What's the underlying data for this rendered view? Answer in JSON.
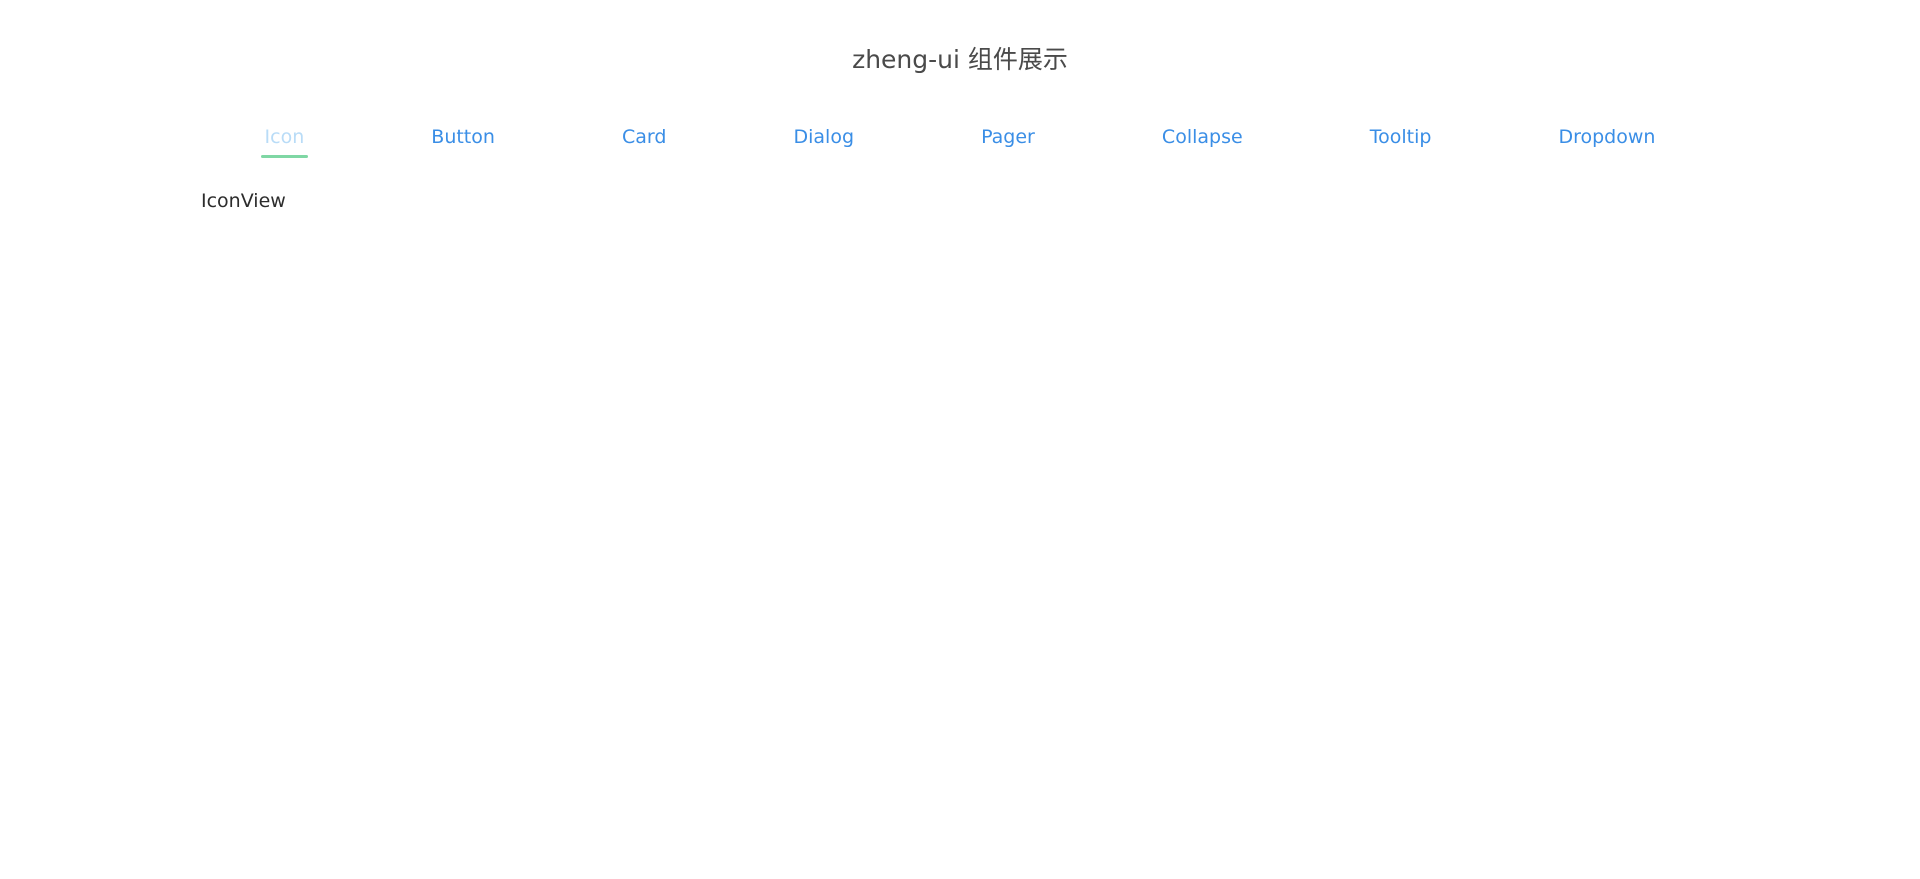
{
  "header": {
    "title": "zheng-ui 组件展示"
  },
  "nav": {
    "items": [
      {
        "label": "Icon",
        "active": true
      },
      {
        "label": "Button",
        "active": false
      },
      {
        "label": "Card",
        "active": false
      },
      {
        "label": "Dialog",
        "active": false
      },
      {
        "label": "Pager",
        "active": false
      },
      {
        "label": "Collapse",
        "active": false
      },
      {
        "label": "Tooltip",
        "active": false
      },
      {
        "label": "Dropdown",
        "active": false
      }
    ]
  },
  "content": {
    "text": "IconView"
  },
  "colors": {
    "link": "#3a8ee6",
    "active_link": "#b9dcf7",
    "active_underline": "#7fd7a4",
    "title": "#4a4a4a"
  }
}
